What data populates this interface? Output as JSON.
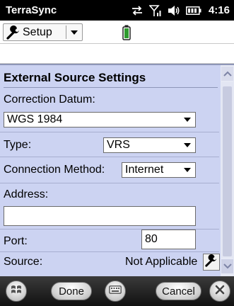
{
  "titlebar": {
    "app_name": "TerraSync",
    "time": "4:16",
    "icons": [
      "sync-arrows-icon",
      "signal-strength-icon",
      "speaker-icon",
      "battery-icon"
    ]
  },
  "toolbar": {
    "setup_label": "Setup",
    "setup_icon": "wrench-icon",
    "dropdown_icon": "chevron-down-icon",
    "status_icon": "battery-icon"
  },
  "panel": {
    "section_title": "External Source Settings",
    "correction_datum": {
      "label": "Correction Datum:",
      "value": "WGS 1984"
    },
    "type": {
      "label": "Type:",
      "value": "VRS"
    },
    "connection_method": {
      "label": "Connection Method:",
      "value": "Internet"
    },
    "address": {
      "label": "Address:",
      "value": ""
    },
    "port": {
      "label": "Port:",
      "value": "80"
    },
    "source": {
      "label": "Source:",
      "value": "Not Applicable"
    }
  },
  "softkeys": {
    "done_label": "Done",
    "cancel_label": "Cancel"
  },
  "colors": {
    "panel_background": "#ccd3f2",
    "title_bar": "#000000"
  }
}
